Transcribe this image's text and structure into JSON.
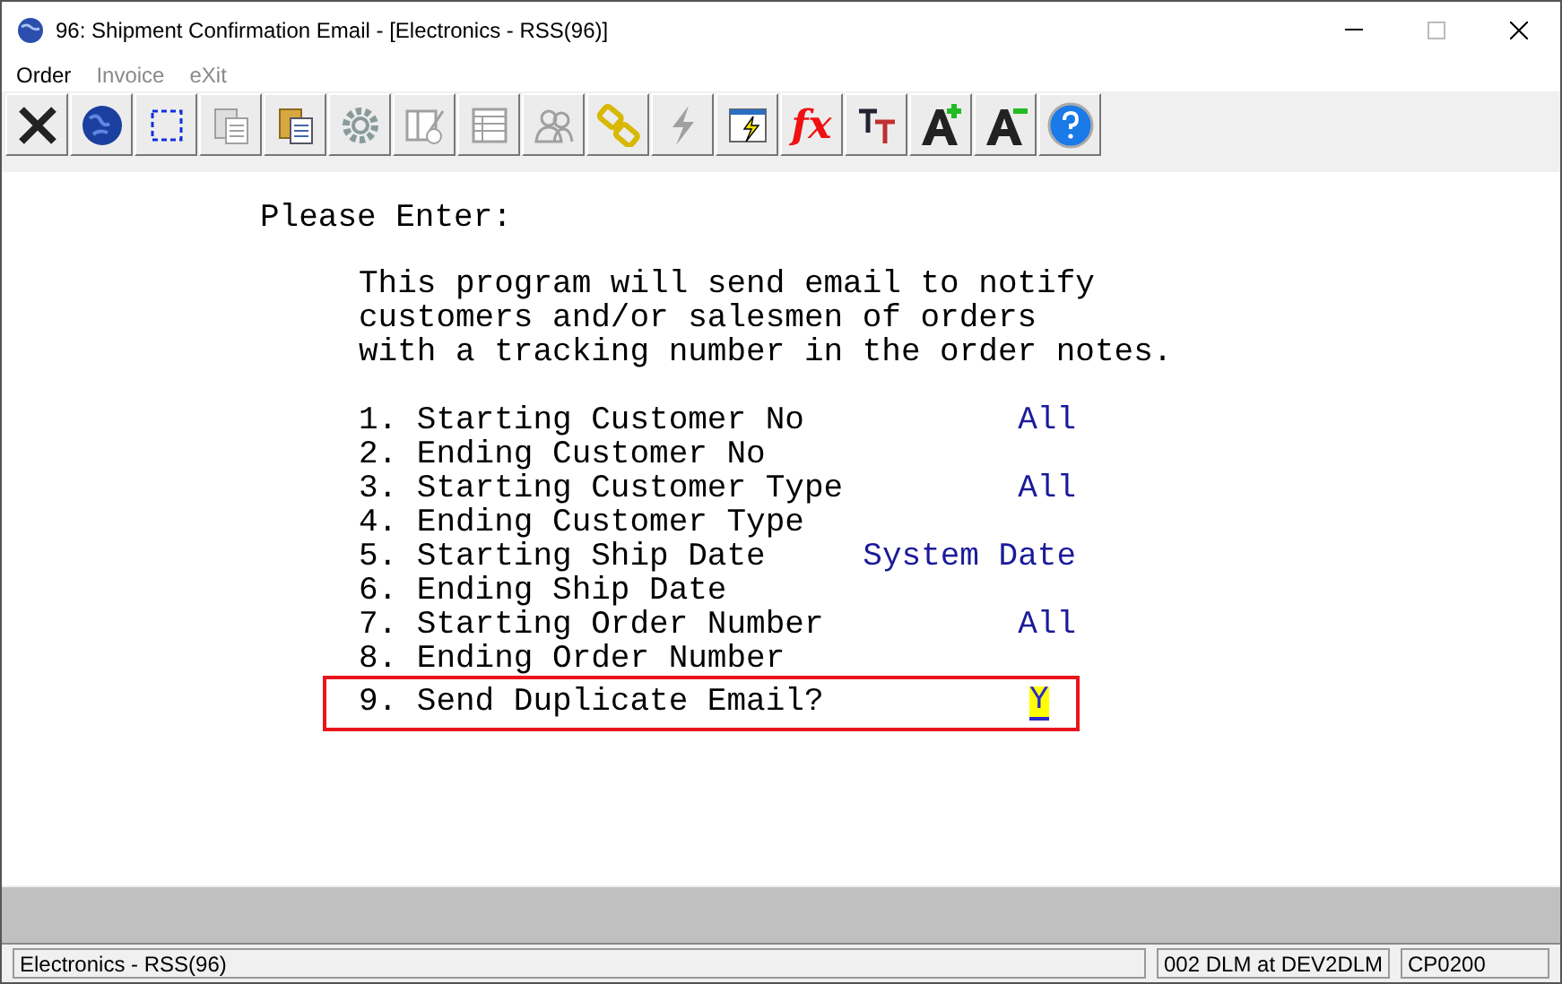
{
  "window": {
    "title": "96: Shipment Confirmation Email - [Electronics - RSS(96)]"
  },
  "menu": [
    {
      "label": "Order",
      "disabled": false
    },
    {
      "label": "Invoice",
      "disabled": true
    },
    {
      "label": "eXit",
      "disabled": true
    }
  ],
  "toolbar": [
    {
      "kind": "close",
      "disabled": false
    },
    {
      "kind": "globe",
      "disabled": false
    },
    {
      "kind": "select",
      "disabled": false
    },
    {
      "kind": "copy",
      "disabled": true
    },
    {
      "kind": "paste",
      "disabled": false
    },
    {
      "kind": "gear",
      "disabled": true
    },
    {
      "kind": "form",
      "disabled": true
    },
    {
      "kind": "table",
      "disabled": true
    },
    {
      "kind": "users",
      "disabled": true
    },
    {
      "kind": "link",
      "disabled": false
    },
    {
      "kind": "bolt",
      "disabled": true
    },
    {
      "kind": "run",
      "disabled": false
    },
    {
      "kind": "fx",
      "disabled": false
    },
    {
      "kind": "font",
      "disabled": false
    },
    {
      "kind": "bigger",
      "disabled": false
    },
    {
      "kind": "smaller",
      "disabled": false
    },
    {
      "kind": "help",
      "disabled": false
    }
  ],
  "form": {
    "heading": "Please Enter:",
    "description": [
      "This program will send email to notify",
      "customers and/or salesmen of orders",
      "with a tracking number in the order notes."
    ],
    "fields": [
      {
        "label": "1. Starting Customer No",
        "value": "All",
        "selected": false
      },
      {
        "label": "2. Ending Customer No",
        "selected": false
      },
      {
        "label": "3. Starting Customer Type",
        "value": "All",
        "selected": false
      },
      {
        "label": "4. Ending Customer Type",
        "selected": false
      },
      {
        "label": "5. Starting Ship Date",
        "value": "System Date",
        "selected": false
      },
      {
        "label": "6. Ending Ship Date",
        "selected": false
      },
      {
        "label": "7. Starting Order Number",
        "value": "All",
        "selected": false
      },
      {
        "label": "8. Ending Order Number",
        "selected": false
      },
      {
        "label": "9. Send Duplicate Email?",
        "value": "Y",
        "selected": true
      }
    ]
  },
  "status_bar": [
    "Electronics - RSS(96)",
    "002 DLM at DEV2DLM",
    "CP0200"
  ]
}
